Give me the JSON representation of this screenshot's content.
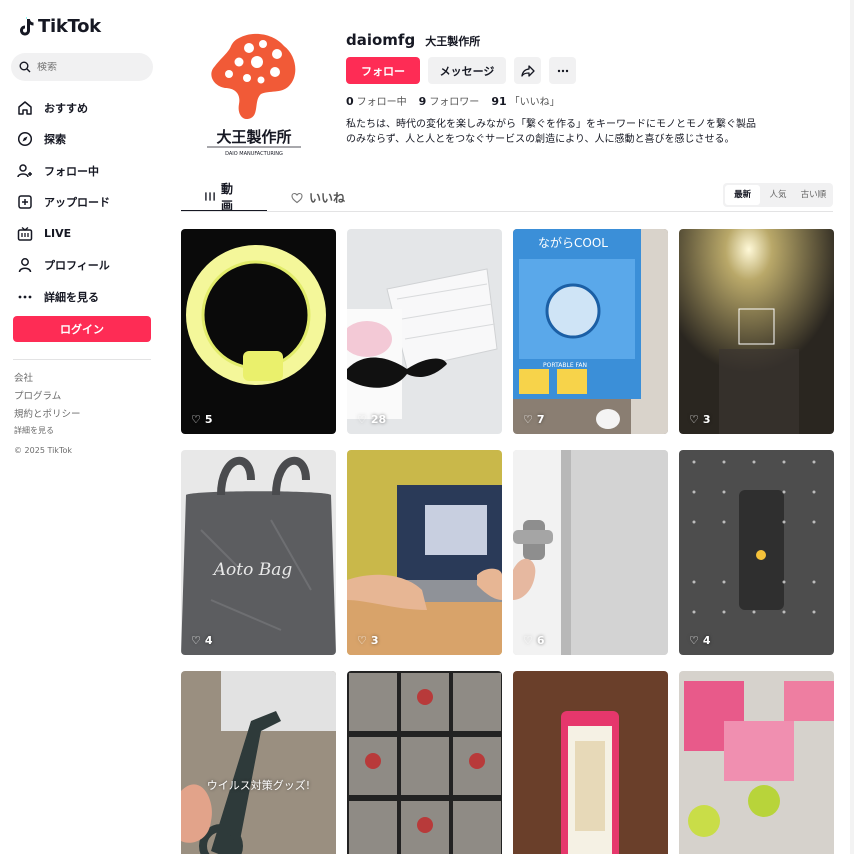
{
  "brand": {
    "name": "TikTok",
    "accent": "#fe2c55"
  },
  "search": {
    "placeholder": "検索"
  },
  "nav": [
    {
      "label": "おすすめ",
      "icon": "home-icon"
    },
    {
      "label": "探索",
      "icon": "compass-icon"
    },
    {
      "label": "フォロー中",
      "icon": "user-follow-icon"
    },
    {
      "label": "アップロード",
      "icon": "upload-icon"
    },
    {
      "label": "LIVE",
      "icon": "live-icon"
    },
    {
      "label": "プロフィール",
      "icon": "profile-icon"
    },
    {
      "label": "詳細を見る",
      "icon": "more-icon"
    }
  ],
  "login_label": "ログイン",
  "footer": {
    "company": "会社",
    "program": "プログラム",
    "terms": "規約とポリシー",
    "more": "詳細を見る",
    "copyright": "© 2025 TikTok"
  },
  "profile": {
    "username": "daiomfg",
    "display_name": "大王製作所",
    "logo_text": "大王製作所",
    "logo_sub": "DAIO MANUFACTURING",
    "follow_label": "フォロー",
    "message_label": "メッセージ",
    "following_count": "0",
    "following_label": "フォロー中",
    "followers_count": "9",
    "followers_label": "フォロワー",
    "likes_count": "91",
    "likes_label": "「いいね」",
    "bio": "私たちは、時代の変化を楽しみながら「繋ぐを作る」をキーワードにモノとモノを繋ぐ製品のみならず、人と人とをつなぐサービスの創造により、人に感動と喜びを感じさせる。"
  },
  "tabs": {
    "videos": "動画",
    "liked": "いいね"
  },
  "sort": {
    "latest": "最新",
    "popular": "人気",
    "oldest": "古い順"
  },
  "videos": [
    {
      "likes": "5"
    },
    {
      "likes": "28"
    },
    {
      "likes": "7",
      "overlay_text": "ながらCOOL",
      "overlay_sub": "PORTABLE FAN"
    },
    {
      "likes": "3"
    },
    {
      "likes": "4",
      "overlay_text": "Aoto Bag"
    },
    {
      "likes": "3"
    },
    {
      "likes": "6"
    },
    {
      "likes": "4"
    },
    {
      "likes": "",
      "caption": "ウイルス対策グッズ!"
    },
    {
      "likes": ""
    },
    {
      "likes": ""
    },
    {
      "likes": ""
    }
  ]
}
